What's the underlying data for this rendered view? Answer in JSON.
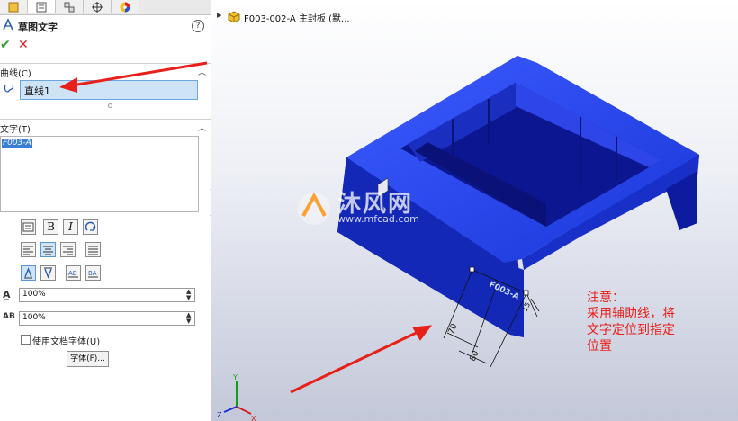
{
  "panel": {
    "tabs": [
      {
        "name": "feature-manager-tab"
      },
      {
        "name": "property-manager-tab"
      },
      {
        "name": "configuration-manager-tab"
      },
      {
        "name": "dimxpert-tab"
      },
      {
        "name": "display-manager-tab"
      }
    ],
    "title": "草图文字",
    "help": "?",
    "ok": "✔",
    "cancel": "✕",
    "curve_section": {
      "label": "曲线(C)",
      "value": "直线1"
    },
    "text_section": {
      "label": "文字(T)",
      "value": "F003-A"
    },
    "format_buttons": {
      "bold": "B",
      "italic": "I"
    },
    "width_factor": "100%",
    "spacing": "100%",
    "use_doc_font_label": "使用文档字体(U)",
    "use_doc_font_checked": false,
    "font_button": "字体(F)..."
  },
  "viewport": {
    "tree_label": "F003-002-A 主封板 (默...",
    "note_lines": [
      "注意：",
      "采用辅助线，将",
      "文字定位到指定",
      "位置"
    ],
    "dimensions": [
      "70",
      "80",
      "15"
    ],
    "embossed_text": "F003-A",
    "watermark": {
      "main": "沐风网",
      "sub": "www.mfcad.com"
    },
    "triad_axes": [
      "X",
      "Y",
      "Z"
    ],
    "colors": {
      "part": "#1f3fe0",
      "annotation": "#e8201a"
    }
  }
}
